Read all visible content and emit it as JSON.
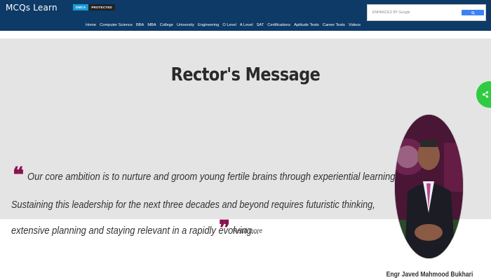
{
  "header": {
    "logo": "MCQs Learn",
    "badge_left": "DMCA",
    "badge_right": "PROTECTED",
    "search": {
      "placeholder": "ENHANCED BY Google",
      "button_icon": "search-icon"
    }
  },
  "nav": {
    "items": [
      "Home",
      "Computer Science",
      "BBA",
      "MBA",
      "College",
      "University",
      "Engineering",
      "O Level",
      "A Level",
      "SAT",
      "Certifications",
      "Aptitude Tests",
      "Career Tests",
      "Videos"
    ]
  },
  "hero": {
    "title": "Rector's Message",
    "quote_lines": [
      "Our core ambition is to nurture and groom young fertile brains through experiential learning.",
      "Sustaining this leadership for the next three decades and beyond requires futuristic thinking,",
      "extensive planning and staying relevant in a rapidly evolving..."
    ],
    "read_more": "Read more",
    "caption": "Engr Javed Mahmood Bukhari"
  },
  "share": {
    "icon": "share-icon",
    "color": "#2ecc40"
  },
  "colors": {
    "header_bg": "#0d3a66",
    "hero_bg": "#e4e4e4",
    "quote_mark": "#8a1150"
  }
}
